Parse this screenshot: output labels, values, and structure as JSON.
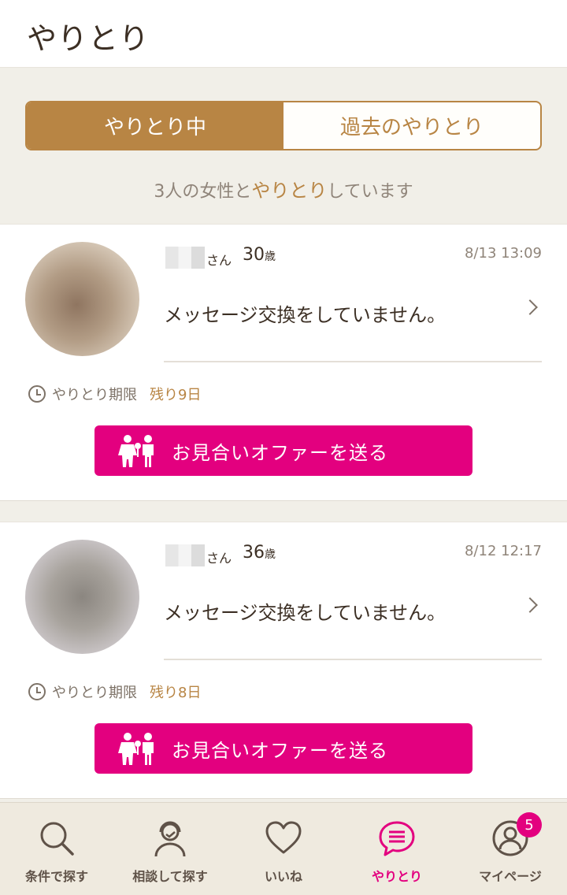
{
  "header": {
    "title": "やりとり"
  },
  "tabs": [
    {
      "label": "やりとり中",
      "active": true
    },
    {
      "label": "過去のやりとり",
      "active": false
    }
  ],
  "summary": {
    "prefix": "3人の女性と",
    "highlight": "やりとり",
    "suffix": "しています"
  },
  "conversations": [
    {
      "name_suffix": "さん",
      "age": "30",
      "age_unit": "歳",
      "datetime": "8/13 13:09",
      "message": "メッセージ交換をしていません。",
      "deadline_label": "やりとり期限",
      "remaining": "残り9日",
      "offer_label": "お見合いオファーを送る"
    },
    {
      "name_suffix": "さん",
      "age": "36",
      "age_unit": "歳",
      "datetime": "8/12 12:17",
      "message": "メッセージ交換をしていません。",
      "deadline_label": "やりとり期限",
      "remaining": "残り8日",
      "offer_label": "お見合いオファーを送る"
    }
  ],
  "bottom_nav": [
    {
      "label": "条件で探す",
      "icon": "search-icon",
      "active": false
    },
    {
      "label": "相談して探す",
      "icon": "consultant-icon",
      "active": false
    },
    {
      "label": "いいね",
      "icon": "heart-icon",
      "active": false
    },
    {
      "label": "やりとり",
      "icon": "chat-icon",
      "active": true
    },
    {
      "label": "マイページ",
      "icon": "profile-icon",
      "active": false,
      "badge": "5"
    }
  ],
  "colors": {
    "accent_gold": "#b88544",
    "brand_pink": "#e3007f",
    "background": "#f1efe8",
    "text": "#3c2f24"
  }
}
